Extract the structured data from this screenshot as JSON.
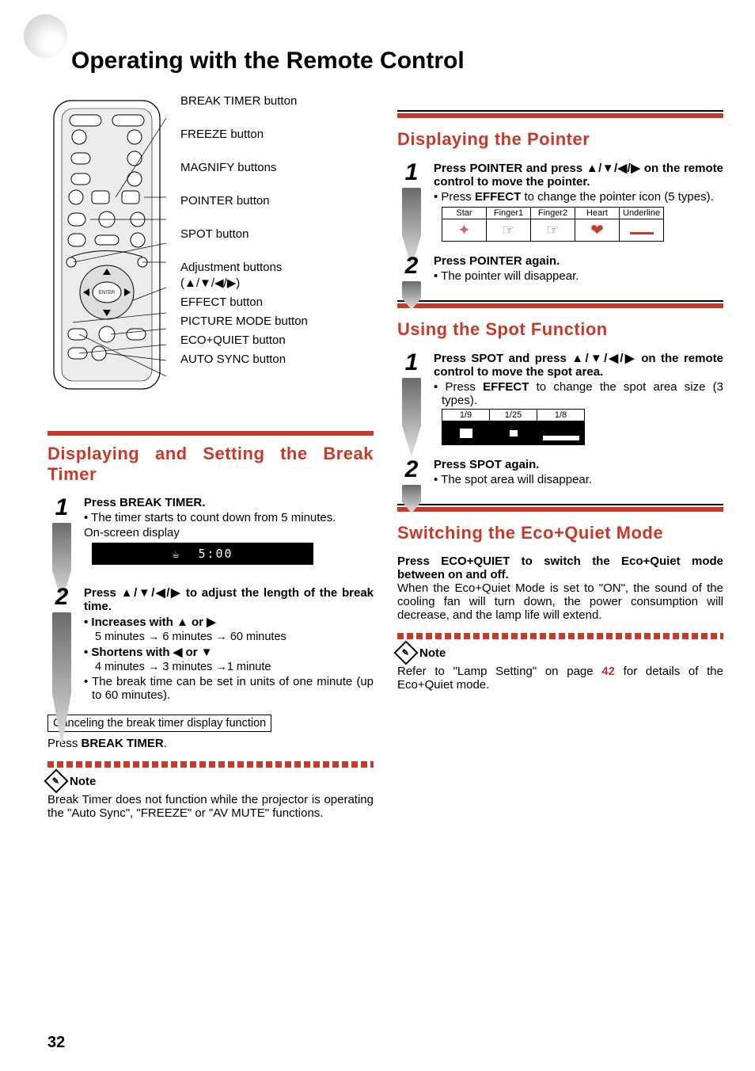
{
  "page": {
    "title": "Operating with the Remote Control",
    "number": "32"
  },
  "remote_labels": {
    "break_timer": "BREAK TIMER button",
    "freeze": "FREEZE button",
    "magnify": "MAGNIFY buttons",
    "pointer": "POINTER button",
    "spot": "SPOT button",
    "adjust": "Adjustment buttons",
    "adjust_sym": "(▲/▼/◀/▶)",
    "effect": "EFFECT button",
    "picture_mode": "PICTURE MODE button",
    "eco_quiet": "ECO+QUIET button",
    "auto_sync": "AUTO SYNC button"
  },
  "break_timer_section": {
    "heading": "Displaying and Setting the Break Timer",
    "step1": {
      "lead_a": "Press ",
      "lead_b": "BREAK TIMER",
      "lead_c": ".",
      "bullet": "The timer starts to count down from 5 minutes.",
      "osd_label": "On-screen display",
      "osd_time": "5:00"
    },
    "step2": {
      "lead": "Press ▲/▼/◀/▶ to adjust the length of the break time.",
      "inc_label": "Increases with ▲ or ▶",
      "inc_seq": "5 minutes → 6 minutes → 60 minutes",
      "dec_label": "Shortens with ◀ or ▼",
      "dec_seq": "4 minutes → 3 minutes →1 minute",
      "bullet": "The break time can be set in units of one minute (up to 60 minutes)."
    },
    "cancel_box": "Canceling the break timer display function",
    "cancel_a": "Press ",
    "cancel_b": "BREAK TIMER",
    "cancel_c": ".",
    "note_label": "Note",
    "note_body": "Break Timer does not function while the projector is operating the \"Auto Sync\", \"FREEZE\" or \"AV MUTE\" functions."
  },
  "pointer_section": {
    "heading": "Displaying the Pointer",
    "step1": {
      "lead_a": "Press ",
      "lead_b": "POINTER",
      "lead_c": " and press ▲/▼/◀/▶ on the remote control to move the pointer.",
      "bullet_a": "Press ",
      "bullet_b": "EFFECT",
      "bullet_c": " to change the pointer icon (5 types)."
    },
    "icons": {
      "star": "Star",
      "finger1": "Finger1",
      "finger2": "Finger2",
      "heart": "Heart",
      "underline": "Underline"
    },
    "step2": {
      "lead_a": "Press ",
      "lead_b": "POINTER",
      "lead_c": " again.",
      "bullet": "The pointer will disappear."
    }
  },
  "spot_section": {
    "heading": "Using the Spot Function",
    "step1": {
      "lead_a": "Press ",
      "lead_b": "SPOT",
      "lead_c": " and press ▲/▼/◀/▶ on the remote control to move the spot area.",
      "bullet_a": "Press ",
      "bullet_b": "EFFECT",
      "bullet_c": " to change the spot area size (3 types)."
    },
    "sizes": {
      "a": "1/9",
      "b": "1/25",
      "c": "1/8"
    },
    "step2": {
      "lead_a": "Press ",
      "lead_b": "SPOT",
      "lead_c": " again.",
      "bullet": "The spot area will disappear."
    }
  },
  "eco_section": {
    "heading": "Switching the Eco+Quiet Mode",
    "lead_a": "Press ",
    "lead_b": "ECO+QUIET",
    "lead_c": " to switch the Eco+Quiet mode between on and off.",
    "bullet": "When the Eco+Quiet Mode is set to \"ON\", the sound of the cooling fan will turn down, the power consumption will decrease, and the lamp life will extend.",
    "note_label": "Note",
    "note_a": "Refer to \"Lamp Setting\" on page ",
    "note_page": "42",
    "note_b": " for details of the Eco+Quiet mode."
  }
}
